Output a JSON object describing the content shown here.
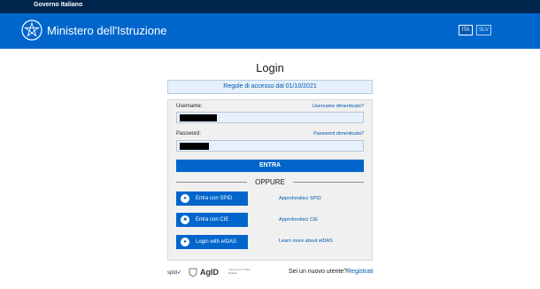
{
  "topbar": {
    "label": "Governo Italiano"
  },
  "header": {
    "title": "Ministero dell'Istruzione",
    "languages": [
      "ITA",
      "SLV"
    ],
    "selected_language": "ITA"
  },
  "page": {
    "title": "Login",
    "rules_link": "Regole di accesso dal 01/10/2021"
  },
  "form": {
    "username_label": "Username:",
    "username_forgot": "Username dimenticato?",
    "username_value": "[redacted]",
    "password_label": "Password:",
    "password_forgot": "Password dimenticata?",
    "password_value": "[redacted]",
    "submit_label": "ENTRA"
  },
  "alternatives": {
    "separator": "OPPURE",
    "items": [
      {
        "button": "Entra con SPID",
        "icon": "spid-user-icon",
        "info": "Approfondisci SPID"
      },
      {
        "button": "Entra con CIE",
        "icon": "cie-id-card-icon",
        "info": "Approfondisci CIE"
      },
      {
        "button": "Login with eIDAS",
        "icon": "eidas-icon",
        "info": "Learn more about eIDAS"
      }
    ]
  },
  "footer": {
    "spid_logo": "spid",
    "agid_logo": "AgID",
    "agid_subtitle": "Agenzia per l'Italia Digitale",
    "new_user": "Sei un nuovo utente?",
    "register": "Registrati"
  },
  "colors": {
    "topbar": "#00264d",
    "header": "#0066cc",
    "link": "#0059b3",
    "panel": "#f0f0f0"
  }
}
